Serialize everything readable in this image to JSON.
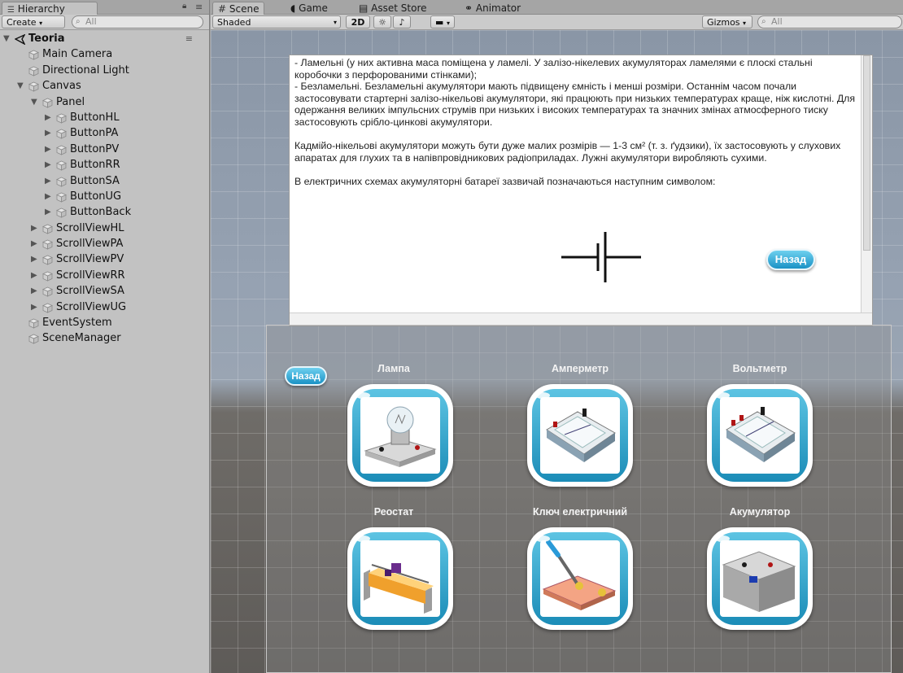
{
  "hierarchy": {
    "tab": "Hierarchy",
    "create": "Create",
    "search_placeholder": "All",
    "items": [
      {
        "label": "Teoria",
        "depth": 0,
        "arrow": "▼",
        "root": true
      },
      {
        "label": "Main Camera",
        "depth": 1,
        "arrow": ""
      },
      {
        "label": "Directional Light",
        "depth": 1,
        "arrow": ""
      },
      {
        "label": "Canvas",
        "depth": 1,
        "arrow": "▼"
      },
      {
        "label": "Panel",
        "depth": 2,
        "arrow": "▼"
      },
      {
        "label": "ButtonHL",
        "depth": 3,
        "arrow": "▶"
      },
      {
        "label": "ButtonPA",
        "depth": 3,
        "arrow": "▶"
      },
      {
        "label": "ButtonPV",
        "depth": 3,
        "arrow": "▶"
      },
      {
        "label": "ButtonRR",
        "depth": 3,
        "arrow": "▶"
      },
      {
        "label": "ButtonSA",
        "depth": 3,
        "arrow": "▶"
      },
      {
        "label": "ButtonUG",
        "depth": 3,
        "arrow": "▶"
      },
      {
        "label": "ButtonBack",
        "depth": 3,
        "arrow": "▶"
      },
      {
        "label": "ScrollViewHL",
        "depth": 2,
        "arrow": "▶"
      },
      {
        "label": "ScrollViewPA",
        "depth": 2,
        "arrow": "▶"
      },
      {
        "label": "ScrollViewPV",
        "depth": 2,
        "arrow": "▶"
      },
      {
        "label": "ScrollViewRR",
        "depth": 2,
        "arrow": "▶"
      },
      {
        "label": "ScrollViewSA",
        "depth": 2,
        "arrow": "▶"
      },
      {
        "label": "ScrollViewUG",
        "depth": 2,
        "arrow": "▶"
      },
      {
        "label": "EventSystem",
        "depth": 1,
        "arrow": ""
      },
      {
        "label": "SceneManager",
        "depth": 1,
        "arrow": ""
      }
    ]
  },
  "scene": {
    "tabs": [
      "Scene",
      "Game",
      "Asset Store",
      "Animator"
    ],
    "shading": "Shaded",
    "mode_2d": "2D",
    "gizmos": "Gizmos",
    "search_placeholder": "All"
  },
  "text_panel": {
    "paragraphs": [
      "- Ламельні (у них активна маса поміщена у ламелі. У залізо-нікелевих акумуляторах ламелями є плоскі стальні коробочки з перфорованими стінками);\n- Безламельні. Безламельні акумулятори мають підвищену ємність і менші розміри. Останнім часом почали застосовувати стартерні залізо-нікельові акумулятори, які працюють при низьких температурах краще, ніж кислотні. Для одержання великих імпульсних струмів при низьких і високих температурах та значних змінах атмосферного тиску застосовують срібло-цинкові акумулятори.",
      "Кадмійо-нікельові акумулятори можуть бути дуже малих розмірів — 1-3 см² (т. з. ґудзики), їх застосовують у слухових апаратах для глухих та в напівпровідникових радіоприладах. Лужні акумулятори виробляють сухими.",
      "В електричних схемах акумуляторні батареї зазвичай позначаються наступним символом:"
    ],
    "back_label": "Назад"
  },
  "grid_panel": {
    "back_label": "Назад",
    "buttons": [
      {
        "label": "Лампа",
        "icon": "lamp-icon"
      },
      {
        "label": "Амперметр",
        "icon": "ammeter-icon"
      },
      {
        "label": "Вольтметр",
        "icon": "voltmeter-icon"
      },
      {
        "label": "Реостат",
        "icon": "rheostat-icon"
      },
      {
        "label": "Ключ електричний",
        "icon": "electric-switch-icon"
      },
      {
        "label": "Акумулятор",
        "icon": "battery-icon"
      }
    ]
  },
  "colors": {
    "tile_ring": "#1b8cb7",
    "back_button": "#1a92c5"
  }
}
